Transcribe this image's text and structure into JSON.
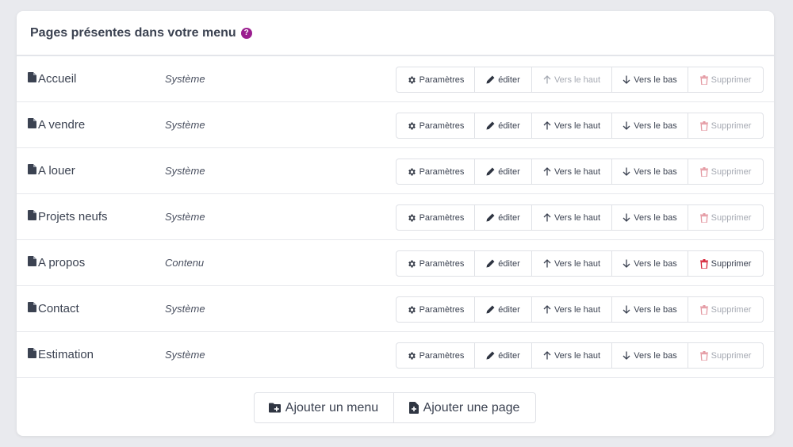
{
  "card": {
    "title": "Pages présentes dans votre menu",
    "help_icon": "question-circle-icon"
  },
  "buttons": {
    "params": "Paramètres",
    "edit": "éditer",
    "up": "Vers le haut",
    "down": "Vers le bas",
    "delete": "Supprimer"
  },
  "rows": [
    {
      "name": "Accueil",
      "type": "Système",
      "up_enabled": false,
      "delete_enabled": false
    },
    {
      "name": "A vendre",
      "type": "Système",
      "up_enabled": true,
      "delete_enabled": false
    },
    {
      "name": "A louer",
      "type": "Système",
      "up_enabled": true,
      "delete_enabled": false
    },
    {
      "name": "Projets neufs",
      "type": "Système",
      "up_enabled": true,
      "delete_enabled": false
    },
    {
      "name": "A propos",
      "type": "Contenu",
      "up_enabled": true,
      "delete_enabled": true
    },
    {
      "name": "Contact",
      "type": "Système",
      "up_enabled": true,
      "delete_enabled": false
    },
    {
      "name": "Estimation",
      "type": "Système",
      "up_enabled": true,
      "delete_enabled": false
    }
  ],
  "footer": {
    "add_menu": "Ajouter un menu",
    "add_page": "Ajouter une page"
  },
  "colors": {
    "help_icon": "#9b1e8f",
    "delete_enabled": "#d6263a",
    "delete_disabled": "#e49aa3",
    "disabled_text": "#a5a9b2"
  }
}
